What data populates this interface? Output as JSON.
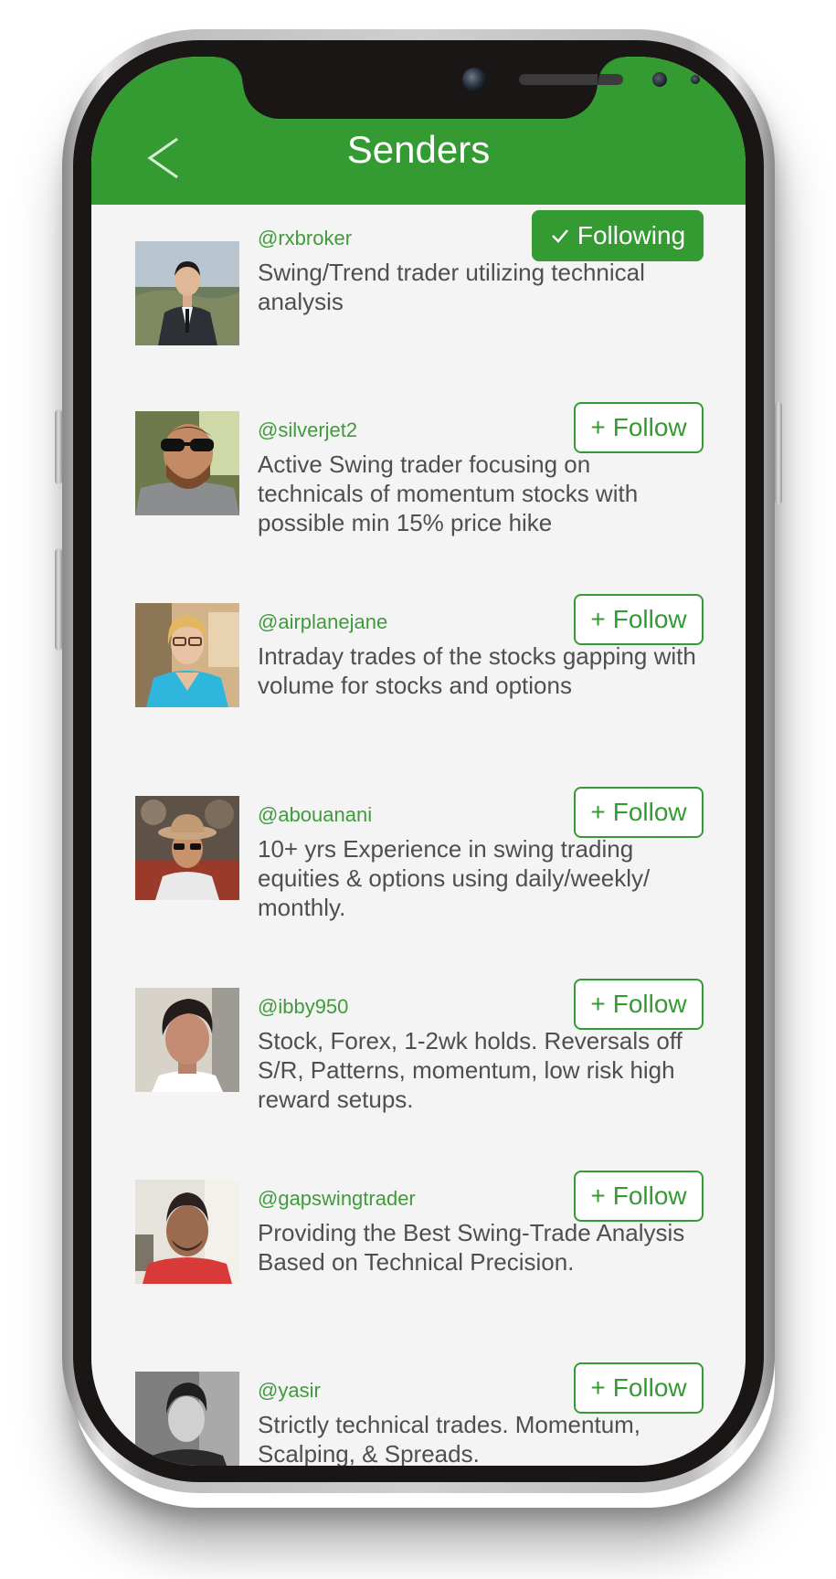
{
  "header": {
    "title": "Senders",
    "accent_color": "#349b32"
  },
  "senders": [
    {
      "handle": "@rxbroker",
      "bio": "Swing/Trend trader utilizing technical analysis",
      "button_label": "Following",
      "button_icon": "checkmark-icon",
      "following": true
    },
    {
      "handle": "@silverjet2",
      "bio": "Active Swing trader focusing on technicals of momentum stocks with possible min 15% price hike",
      "button_label": "Follow",
      "button_icon": "plus-icon",
      "following": false
    },
    {
      "handle": "@airplanejane",
      "bio": "Intraday trades of the stocks gapping with volume for stocks and options",
      "button_label": "Follow",
      "button_icon": "plus-icon",
      "following": false
    },
    {
      "handle": "@abouanani",
      "bio": "10+ yrs Experience in swing trading equities & options using daily/weekly/ monthly.",
      "button_label": "Follow",
      "button_icon": "plus-icon",
      "following": false
    },
    {
      "handle": "@ibby950",
      "bio": "Stock, Forex, 1-2wk holds. Reversals off S/R, Patterns, momentum, low risk high reward setups.",
      "button_label": "Follow",
      "button_icon": "plus-icon",
      "following": false
    },
    {
      "handle": "@gapswingtrader",
      "bio": "Providing the Best Swing-Trade Analysis Based on Technical Precision.",
      "button_label": "Follow",
      "button_icon": "plus-icon",
      "following": false
    },
    {
      "handle": "@yasir",
      "bio": "Strictly technical trades. Momentum, Scalping, & Spreads.",
      "button_label": "Follow",
      "button_icon": "plus-icon",
      "following": false
    }
  ]
}
